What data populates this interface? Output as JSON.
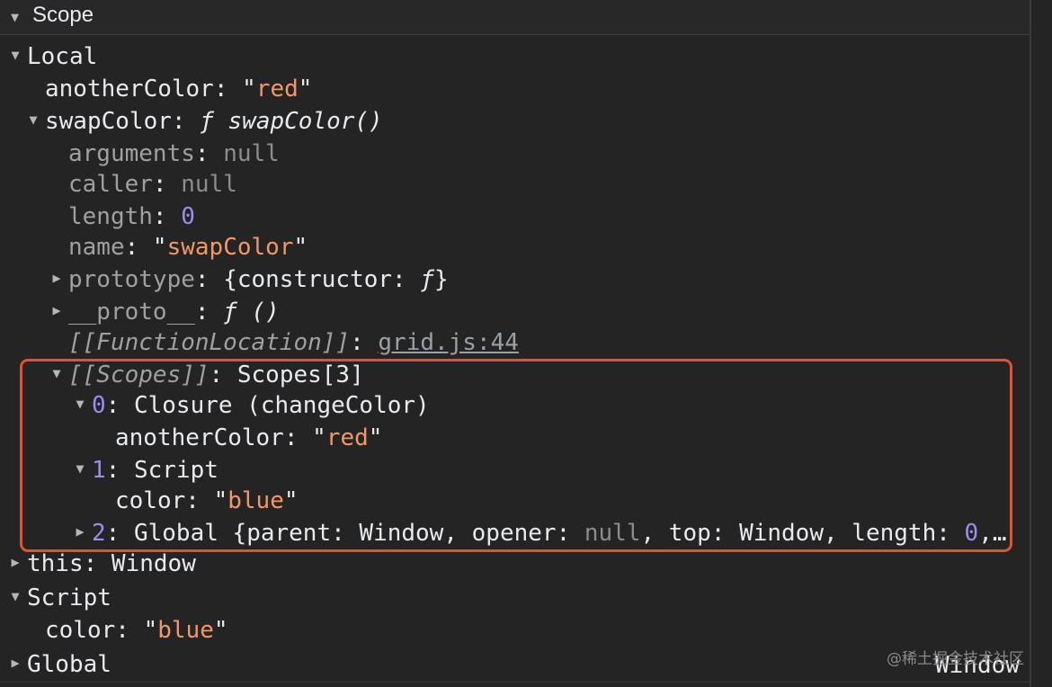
{
  "header": {
    "title": "Scope"
  },
  "rows": [
    {
      "id": "local",
      "toggle": "▼",
      "parts": [
        {
          "t": "Local",
          "c": "k"
        }
      ]
    },
    {
      "id": "anotherColor",
      "toggle": "",
      "parts": [
        {
          "t": "anotherColor",
          "c": "k"
        },
        {
          "t": ": \"",
          "c": "p"
        },
        {
          "t": "red",
          "c": "str"
        },
        {
          "t": "\"",
          "c": "p"
        }
      ]
    },
    {
      "id": "swapColor",
      "toggle": "▼",
      "parts": [
        {
          "t": "swapColor",
          "c": "k"
        },
        {
          "t": ": ",
          "c": "p"
        },
        {
          "t": "ƒ swapColor()",
          "c": "p it"
        }
      ]
    },
    {
      "id": "arguments",
      "toggle": "",
      "parts": [
        {
          "t": "arguments",
          "c": "kdim"
        },
        {
          "t": ": ",
          "c": "p"
        },
        {
          "t": "null",
          "c": "nul"
        }
      ]
    },
    {
      "id": "caller",
      "toggle": "",
      "parts": [
        {
          "t": "caller",
          "c": "kdim"
        },
        {
          "t": ": ",
          "c": "p"
        },
        {
          "t": "null",
          "c": "nul"
        }
      ]
    },
    {
      "id": "length",
      "toggle": "",
      "parts": [
        {
          "t": "length",
          "c": "kdim"
        },
        {
          "t": ": ",
          "c": "p"
        },
        {
          "t": "0",
          "c": "num"
        }
      ]
    },
    {
      "id": "name",
      "toggle": "",
      "parts": [
        {
          "t": "name",
          "c": "kdim"
        },
        {
          "t": ": \"",
          "c": "p"
        },
        {
          "t": "swapColor",
          "c": "str"
        },
        {
          "t": "\"",
          "c": "p"
        }
      ]
    },
    {
      "id": "prototype",
      "toggle": "▶",
      "parts": [
        {
          "t": "prototype",
          "c": "kdim"
        },
        {
          "t": ": {constructor: ",
          "c": "p"
        },
        {
          "t": "ƒ",
          "c": "p it"
        },
        {
          "t": "}",
          "c": "p"
        }
      ]
    },
    {
      "id": "proto",
      "toggle": "▶",
      "parts": [
        {
          "t": "__proto__",
          "c": "kdim"
        },
        {
          "t": ": ",
          "c": "p"
        },
        {
          "t": "ƒ ()",
          "c": "p it"
        }
      ]
    },
    {
      "id": "functionLocation",
      "toggle": "",
      "parts": [
        {
          "t": "[[FunctionLocation]]",
          "c": "kdim it"
        },
        {
          "t": ": ",
          "c": "p"
        },
        {
          "t": "grid.js:44",
          "c": "link"
        }
      ]
    },
    {
      "id": "scopes",
      "toggle": "▼",
      "parts": [
        {
          "t": "[[Scopes]]",
          "c": "kdim it"
        },
        {
          "t": ": Scopes[3]",
          "c": "p"
        }
      ]
    },
    {
      "id": "scope0",
      "toggle": "▼",
      "parts": [
        {
          "t": "0",
          "c": "num"
        },
        {
          "t": ": Closure (changeColor)",
          "c": "p"
        }
      ]
    },
    {
      "id": "scope0-anotherColor",
      "toggle": "",
      "parts": [
        {
          "t": "anotherColor",
          "c": "k"
        },
        {
          "t": ": \"",
          "c": "p"
        },
        {
          "t": "red",
          "c": "str"
        },
        {
          "t": "\"",
          "c": "p"
        }
      ]
    },
    {
      "id": "scope1",
      "toggle": "▼",
      "parts": [
        {
          "t": "1",
          "c": "num"
        },
        {
          "t": ": Script",
          "c": "p"
        }
      ]
    },
    {
      "id": "scope1-color",
      "toggle": "",
      "parts": [
        {
          "t": "color",
          "c": "k"
        },
        {
          "t": ": \"",
          "c": "p"
        },
        {
          "t": "blue",
          "c": "str"
        },
        {
          "t": "\"",
          "c": "p"
        }
      ]
    },
    {
      "id": "scope2",
      "toggle": "▶",
      "parts": [
        {
          "t": "2",
          "c": "num"
        },
        {
          "t": ": Global {parent: Window, opener: ",
          "c": "p"
        },
        {
          "t": "null",
          "c": "nul"
        },
        {
          "t": ", top: Window, length: ",
          "c": "p"
        },
        {
          "t": "0",
          "c": "num"
        },
        {
          "t": ",…",
          "c": "p"
        }
      ]
    },
    {
      "id": "this",
      "toggle": "▶",
      "parts": [
        {
          "t": "this",
          "c": "k"
        },
        {
          "t": ": Window",
          "c": "p"
        }
      ]
    },
    {
      "id": "script",
      "toggle": "▼",
      "parts": [
        {
          "t": "Script",
          "c": "k"
        }
      ]
    },
    {
      "id": "script-color",
      "toggle": "",
      "parts": [
        {
          "t": "color",
          "c": "k"
        },
        {
          "t": ": \"",
          "c": "p"
        },
        {
          "t": "blue",
          "c": "str"
        },
        {
          "t": "\"",
          "c": "p"
        }
      ]
    },
    {
      "id": "global",
      "toggle": "▶",
      "parts": [
        {
          "t": "Global",
          "c": "k"
        }
      ]
    }
  ],
  "global_value": "Window",
  "watermark": "@稀土掘金技术社区",
  "colors": {
    "highlight": "#e5512a",
    "string": "#f29766",
    "number": "#9b8cf2",
    "null": "#8c8c8c"
  }
}
